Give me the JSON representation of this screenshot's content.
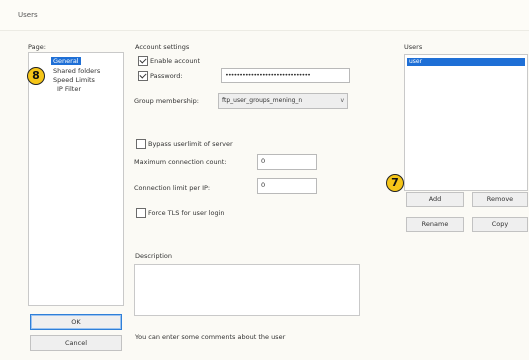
{
  "window": {
    "title": "Users"
  },
  "page_label": "Page:",
  "tree": {
    "items": [
      {
        "label": "General",
        "selected": true
      },
      {
        "label": "Shared folders"
      },
      {
        "label": "Speed Limits"
      },
      {
        "label": "IP Filter"
      }
    ]
  },
  "account": {
    "group_label": "Account settings",
    "enable_label": "Enable account",
    "enable_checked": true,
    "password_label": "Password:",
    "password_checked": true,
    "password_value": "••••••••••••••••••••••••••••••",
    "group_membership_label": "Group membership:",
    "group_membership_value": "ftp_user_groups_mening_n"
  },
  "limits": {
    "bypass_label": "Bypass userlimit of server",
    "max_conn_label": "Maximum connection count:",
    "max_conn_value": "0",
    "conn_ip_label": "Connection limit per IP:",
    "conn_ip_value": "0",
    "force_tls_label": "Force TLS for user login"
  },
  "description": {
    "label": "Description",
    "hint": "You can enter some comments about the user"
  },
  "users": {
    "label": "Users",
    "selected_user": "user",
    "add_label": "Add",
    "remove_label": "Remove",
    "rename_label": "Rename",
    "copy_label": "Copy"
  },
  "buttons": {
    "ok_label": "OK",
    "cancel_label": "Cancel"
  },
  "markers": {
    "m8": "8",
    "m7": "7"
  },
  "colors": {
    "selection": "#1e6fd6",
    "marker": "#f5c518",
    "background": "#fbfaf5"
  }
}
